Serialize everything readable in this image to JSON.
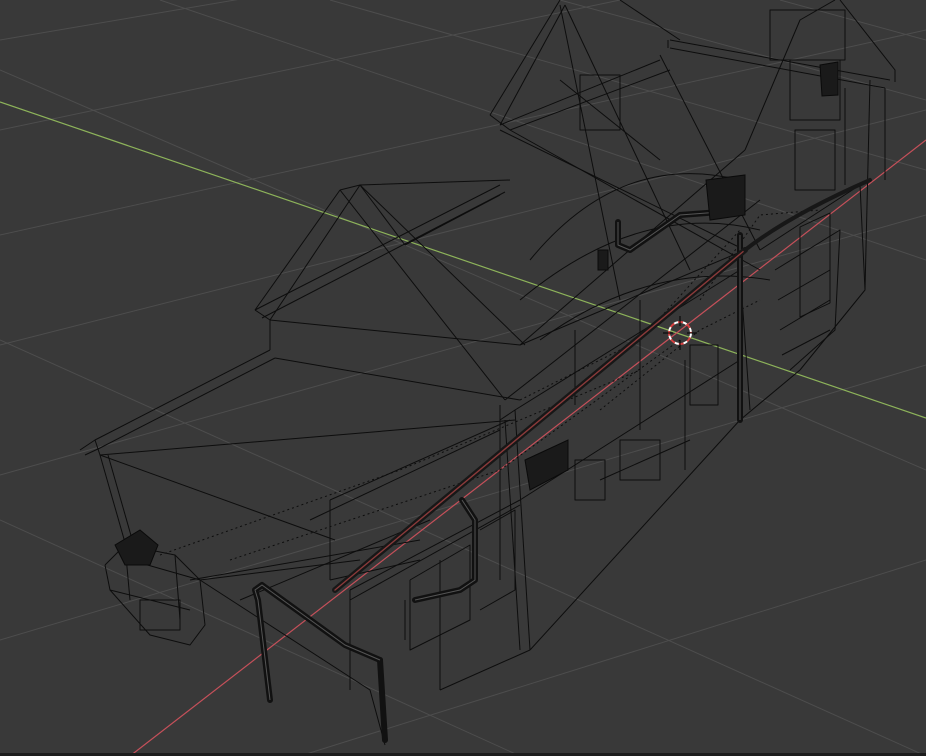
{
  "viewport": {
    "mode": "wireframe",
    "background_color": "#393939",
    "grid_color": "#4d4d4d",
    "x_axis_color": "#c5505a",
    "y_axis_color": "#8db35a",
    "wire_color": "#0d0d0d",
    "selected_edge_color": "#8a3a3a",
    "cursor_icon": "3d-cursor-icon",
    "cursor_colors": [
      "#ffffff",
      "#d64040"
    ]
  }
}
